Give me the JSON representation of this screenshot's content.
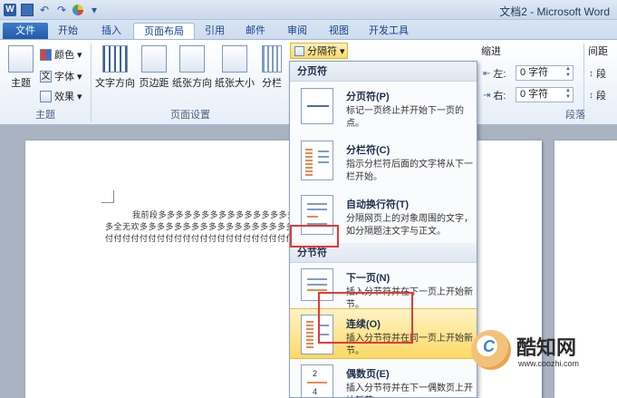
{
  "window": {
    "title": "文档2 - Microsoft Word"
  },
  "quick_access": {
    "icons": [
      "word-logo-icon",
      "save-icon",
      "undo-icon",
      "redo-icon",
      "format-painter-icon",
      "paint-icon",
      "customize-icon"
    ],
    "word_logo_text": "W"
  },
  "tabs": [
    {
      "label": "文件"
    },
    {
      "label": "开始"
    },
    {
      "label": "插入"
    },
    {
      "label": "页面布局"
    },
    {
      "label": "引用"
    },
    {
      "label": "邮件"
    },
    {
      "label": "审阅"
    },
    {
      "label": "视图"
    },
    {
      "label": "开发工具"
    }
  ],
  "ribbon": {
    "theme_group": {
      "label": "主题",
      "theme_btn": "主题",
      "colors": "颜色",
      "fonts": "字体",
      "effects": "效果",
      "fonts_glyph": "文"
    },
    "page_setup_group": {
      "label": "页面设置",
      "text_direction": "文字方向",
      "margins": "页边距",
      "orientation": "纸张方向",
      "size": "纸张大小",
      "columns": "分栏"
    },
    "separator_button": "分隔符",
    "indent": {
      "title": "缩进",
      "left_label": "左:",
      "left_value": "0 字符",
      "right_label": "右:",
      "right_value": "0 字符"
    },
    "spacing": {
      "title": "间距",
      "before": "段",
      "after": "段"
    },
    "paragraph_group": {
      "label": "段落"
    }
  },
  "document": {
    "lines": [
      "我前段多多多多多多多多多多多多多多多多",
      "多全无欢多多多多多多多多多多多多多多多多多多",
      "付付付付付付付付付付付付付付付付付付付付付付"
    ]
  },
  "dropdown": {
    "page_breaks_header": "分页符",
    "section_breaks_header": "分节符",
    "page_break_items": [
      {
        "title": "分页符(P)",
        "desc": "标记一页终止并开始下一页的点。"
      },
      {
        "title": "分栏符(C)",
        "desc": "指示分栏符后面的文字将从下一栏开始。"
      },
      {
        "title": "自动换行符(T)",
        "desc": "分隔网页上的对象周围的文字，如分隔题注文字与正文。"
      }
    ],
    "section_break_items": [
      {
        "title": "下一页(N)",
        "desc": "插入分节符并在下一页上开始新节。"
      },
      {
        "title": "连续(O)",
        "desc": "插入分节符并在同一页上开始新节。"
      },
      {
        "title": "偶数页(E)",
        "desc": "插入分节符并在下一偶数页上开始新节。"
      }
    ]
  },
  "watermark": {
    "text": "酷知网",
    "url": "www.coozhi.com",
    "logo_letter": "C"
  }
}
